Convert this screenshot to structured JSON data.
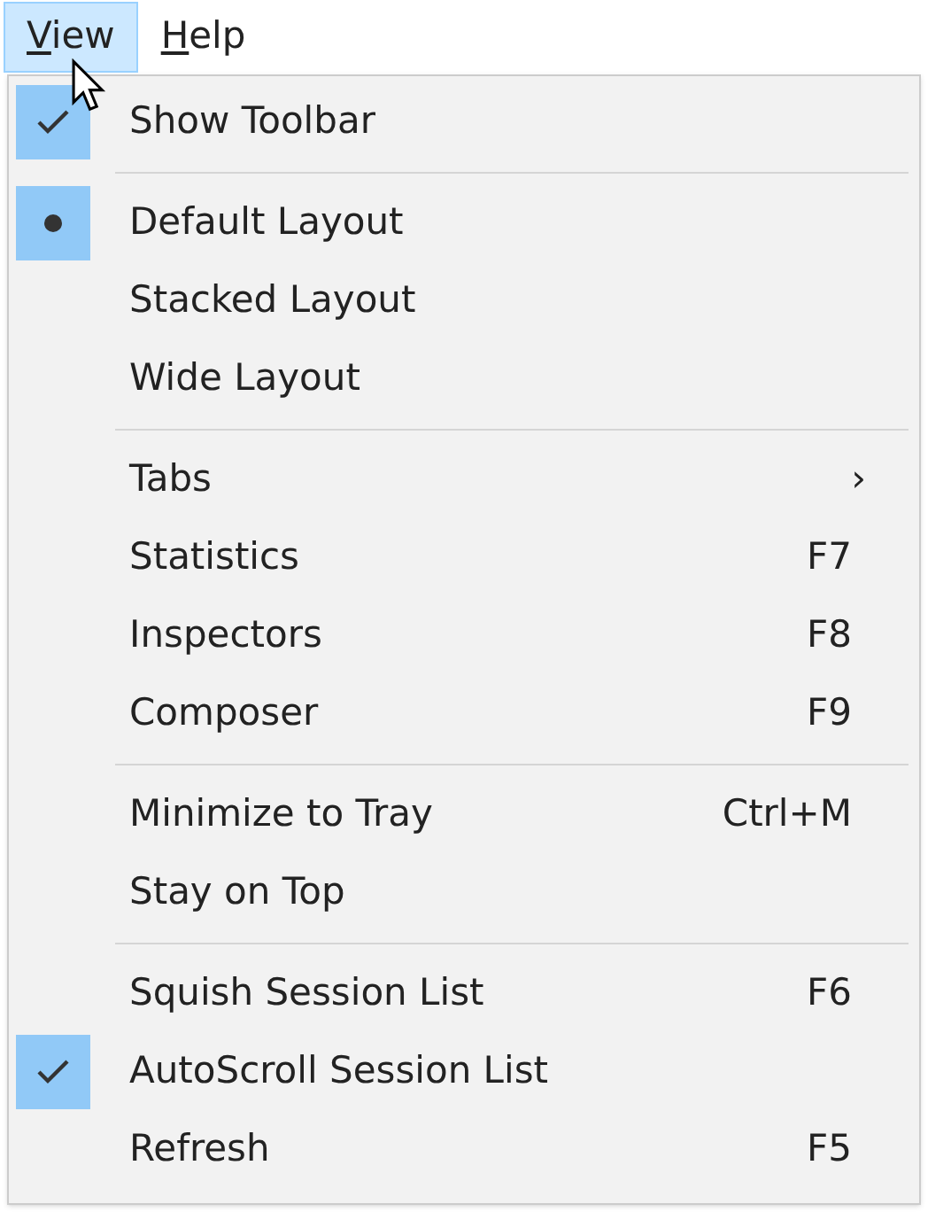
{
  "menu_bar": [
    {
      "label": "View",
      "mnemonic": true,
      "selected": true
    },
    {
      "label": "Help",
      "mnemonic": true,
      "selected": false
    }
  ],
  "menu": {
    "sections": [
      [
        {
          "kind": "check",
          "label": "Show Toolbar",
          "checked": true
        }
      ],
      [
        {
          "kind": "radio",
          "label": "Default Layout",
          "checked": true
        },
        {
          "kind": "radio",
          "label": "Stacked Layout",
          "checked": false
        },
        {
          "kind": "radio",
          "label": "Wide Layout",
          "checked": false
        }
      ],
      [
        {
          "kind": "submenu",
          "label": "Tabs",
          "submenu_arrow": "›"
        },
        {
          "kind": "plain",
          "label": "Statistics",
          "shortcut": "F7"
        },
        {
          "kind": "plain",
          "label": "Inspectors",
          "shortcut": "F8"
        },
        {
          "kind": "plain",
          "label": "Composer",
          "shortcut": "F9"
        }
      ],
      [
        {
          "kind": "plain",
          "label": "Minimize to Tray",
          "shortcut": "Ctrl+M"
        },
        {
          "kind": "plain",
          "label": "Stay on Top"
        }
      ],
      [
        {
          "kind": "check",
          "label": "Squish Session List",
          "shortcut": "F6",
          "checked": false
        },
        {
          "kind": "check",
          "label": "AutoScroll Session List",
          "checked": true
        },
        {
          "kind": "plain",
          "label": "Refresh",
          "shortcut": "F5"
        }
      ]
    ]
  }
}
